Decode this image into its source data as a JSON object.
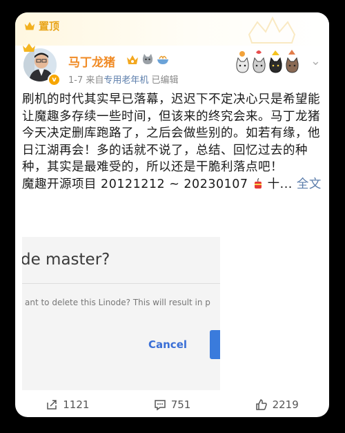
{
  "pin_label": "置顶",
  "user": {
    "name": "马丁龙猪"
  },
  "meta": {
    "date": "1-7",
    "source_prefix": "来自",
    "source": "专用老年机",
    "edited": "已编辑"
  },
  "post": {
    "paragraph": "刷机的时代其实早已落幕，迟迟下不定决心只是希望能让魔趣多存续一些时间，但该来的终究会来。马丁龙猪今天决定删库跑路了，之后会做些别的。如若有缘，他日江湖再会！多的话就不说了，总结、回忆过去的种种，其实是最难受的，所以还是干脆利落点吧！",
    "line_last": "魔趣开源项目 20121212 ~ 20230107",
    "trunc": " 十...",
    "full_text": "全文"
  },
  "screenshot": {
    "title": "de master?",
    "message": "ant to delete this Linode? This will result in p",
    "cancel": "Cancel"
  },
  "actions": {
    "share": "1121",
    "comments": "751",
    "likes": "2219"
  },
  "colors": {
    "accent": "#f08a24",
    "link": "#5b7dab",
    "pin": "#e8a317"
  }
}
